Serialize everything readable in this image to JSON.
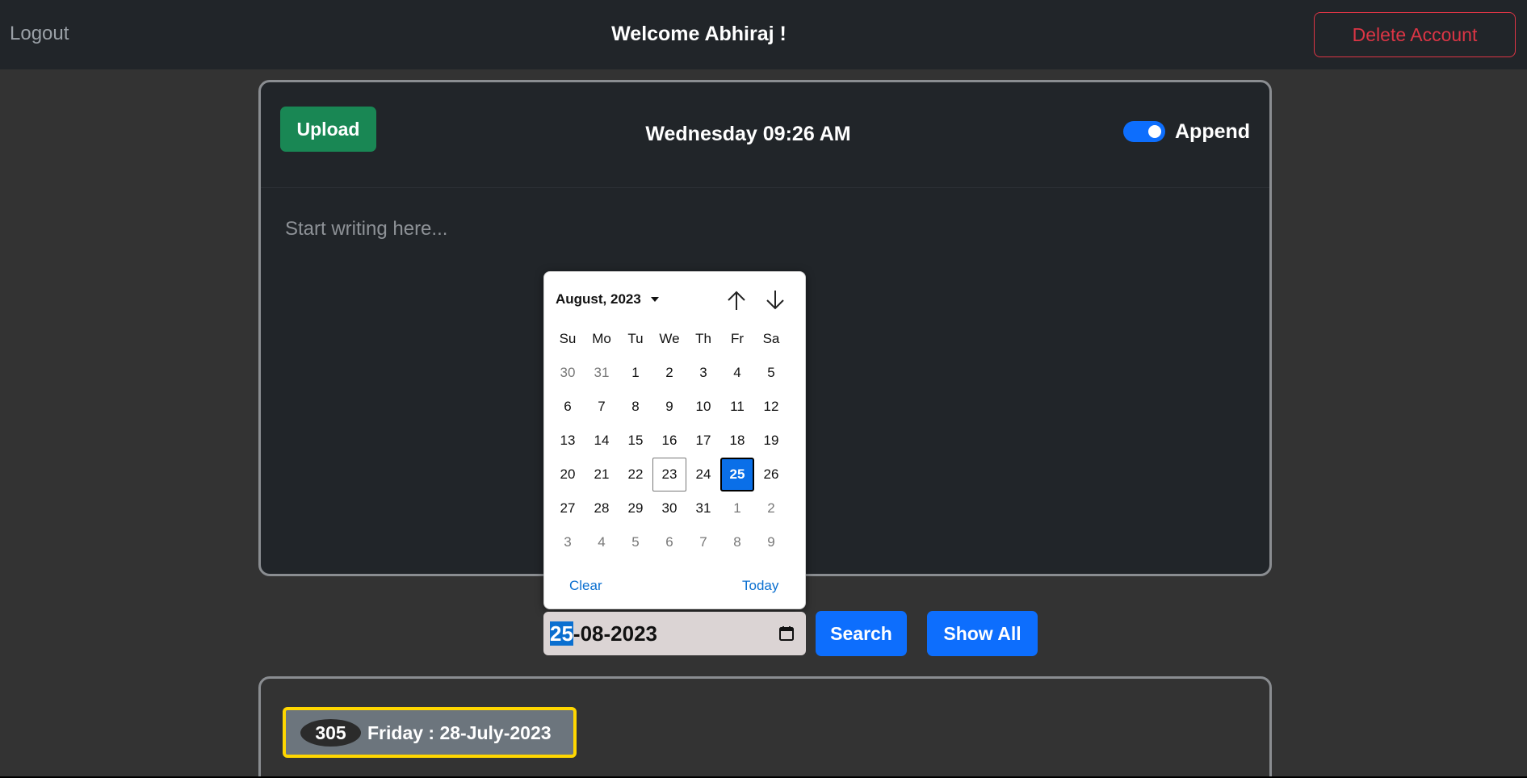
{
  "navbar": {
    "logout_label": "Logout",
    "welcome": "Welcome Abhiraj !",
    "delete_label": "Delete Account"
  },
  "editor_card": {
    "upload_label": "Upload",
    "datetime": "Wednesday 09:26 AM",
    "append_label": "Append",
    "append_on": true,
    "placeholder": "Start writing here..."
  },
  "calendar": {
    "month_label": "August, 2023",
    "weekdays": [
      "Su",
      "Mo",
      "Tu",
      "We",
      "Th",
      "Fr",
      "Sa"
    ],
    "weeks": [
      [
        "30",
        "31",
        "1",
        "2",
        "3",
        "4",
        "5"
      ],
      [
        "6",
        "7",
        "8",
        "9",
        "10",
        "11",
        "12"
      ],
      [
        "13",
        "14",
        "15",
        "16",
        "17",
        "18",
        "19"
      ],
      [
        "20",
        "21",
        "22",
        "23",
        "24",
        "25",
        "26"
      ],
      [
        "27",
        "28",
        "29",
        "30",
        "31",
        "1",
        "2"
      ],
      [
        "3",
        "4",
        "5",
        "6",
        "7",
        "8",
        "9"
      ]
    ],
    "today_day": "23",
    "selected_day": "25",
    "clear_label": "Clear",
    "today_label": "Today"
  },
  "search": {
    "date_day": "25",
    "date_rest": "-08-2023",
    "search_label": "Search",
    "show_all_label": "Show All"
  },
  "entries": [
    {
      "count": "305",
      "label": "Friday : 28-July-2023"
    }
  ],
  "colors": {
    "background": "#333333",
    "navbar": "#212529",
    "danger": "#dc3545",
    "success": "#198754",
    "primary": "#0d6efd",
    "highlight_border": "#ffd700"
  }
}
